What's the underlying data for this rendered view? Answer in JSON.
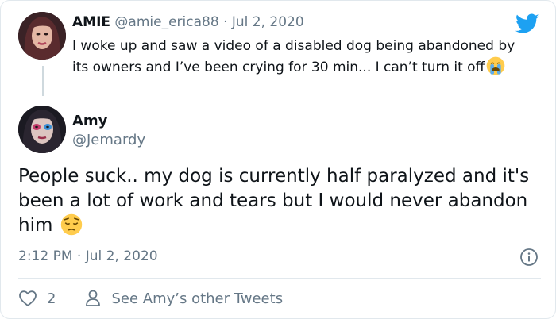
{
  "quoted_tweet": {
    "display_name": "AMIE",
    "handle": "@amie_erica88",
    "separator": "·",
    "date": "Jul 2, 2020",
    "text": "I woke up and saw a video of a disabled dog being abandoned by its owners and I’ve been crying for 30 min... I can’t turn it off",
    "emoji": "loudly-crying-face"
  },
  "reply": {
    "display_name": "Amy",
    "handle": "@Jemardy",
    "text": "People suck.. my dog is currently half paralyzed and it's been a lot of work and tears but I would never abandon him",
    "emoji": "pensive-face",
    "timestamp": "2:12 PM · Jul 2, 2020"
  },
  "actions": {
    "like_count": "2",
    "profile_link_label": "See Amy’s other Tweets"
  },
  "icons": {
    "brand": "twitter-bird-icon",
    "info": "info-icon",
    "like": "heart-icon",
    "profile": "person-icon"
  },
  "colors": {
    "brand": "#1da1f2",
    "muted_text": "#657786",
    "primary_text": "#0f1419",
    "border": "#e1e8ed"
  }
}
